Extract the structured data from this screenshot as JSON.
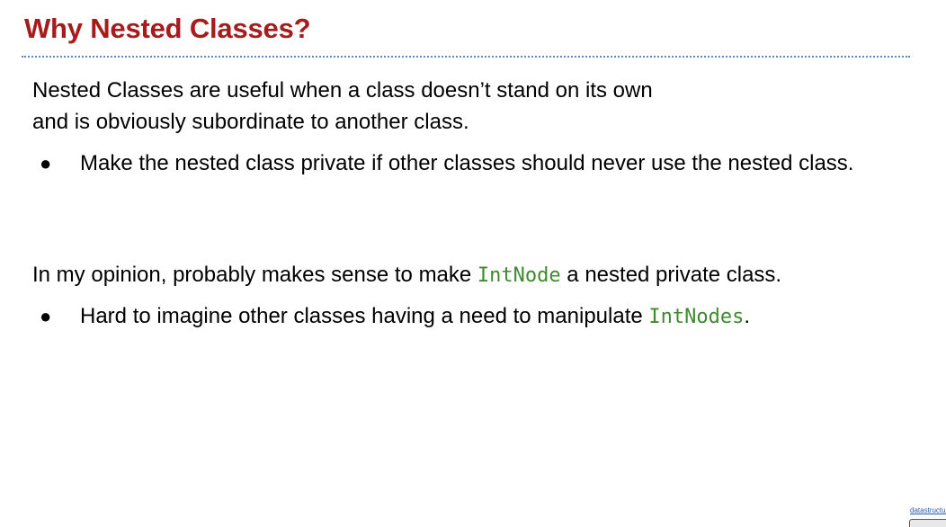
{
  "slide": {
    "title": "Why Nested Classes?",
    "para1_line1": "Nested Classes are useful when a class doesn’t stand on its own",
    "para1_line2": "and is obviously subordinate to another class.",
    "bullet1": "Make the nested class private if other classes should never use the nested class.",
    "para2_before": "In my opinion, probably makes sense to make ",
    "para2_code": "IntNode",
    "para2_after": " a nested private class.",
    "bullet2_before": "Hard to imagine other classes having a need to manipulate ",
    "bullet2_code": "IntNodes",
    "bullet2_after": ".",
    "bullet_glyph": "●"
  },
  "footer": {
    "link_text": "datastructur.es"
  },
  "colors": {
    "title": "#a61c1c",
    "code": "#3d8b2e",
    "divider": "#5b84c8"
  }
}
